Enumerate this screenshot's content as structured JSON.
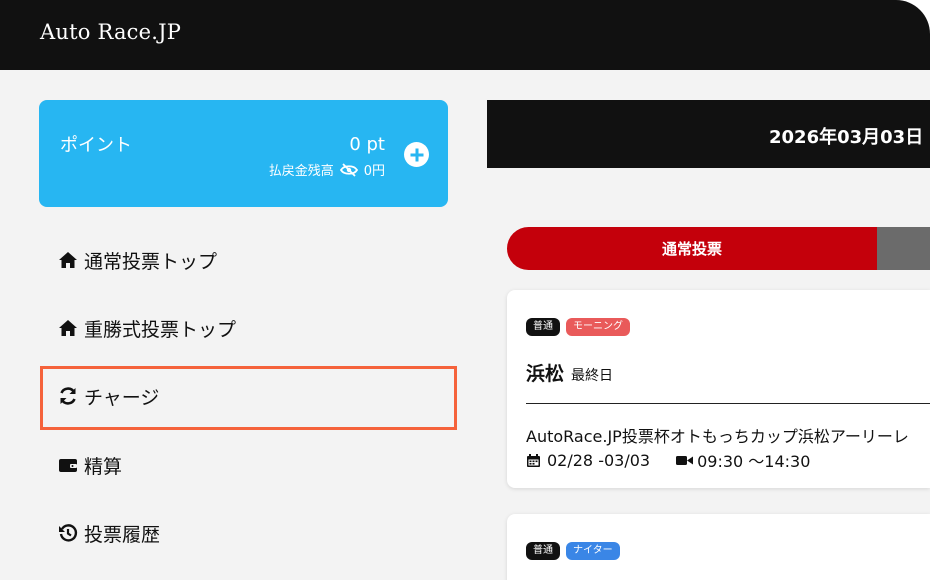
{
  "header": {
    "brand": "Auto Race.JP"
  },
  "points": {
    "label": "ポイント",
    "value": "0 pt",
    "refund_label": "払戻金残高",
    "refund_value": "0円"
  },
  "nav": [
    {
      "label": "通常投票トップ",
      "icon": "home-icon"
    },
    {
      "label": "重勝式投票トップ",
      "icon": "home-icon"
    },
    {
      "label": "チャージ",
      "icon": "sync-icon"
    },
    {
      "label": "精算",
      "icon": "wallet-icon"
    },
    {
      "label": "投票履歴",
      "icon": "history-icon"
    }
  ],
  "date_bar": {
    "date": "2026年03月03日"
  },
  "tabs": {
    "active": "通常投票"
  },
  "cards": [
    {
      "badges": [
        "普通",
        "モーニング"
      ],
      "venue": "浜松",
      "day": "最終日",
      "title": "AutoRace.JP投票杯オトもっちカップ浜松アーリーレ",
      "dates": "02/28 -03/03",
      "time": "09:30 〜14:30"
    },
    {
      "badges": [
        "普通",
        "ナイター"
      ]
    }
  ],
  "colors": {
    "header_bg": "#111111",
    "points_bg": "#27b6f2",
    "tab_active": "#c4000b",
    "highlight": "#f5623b",
    "badge_morning": "#e95a5a",
    "badge_night": "#3a86e6"
  }
}
